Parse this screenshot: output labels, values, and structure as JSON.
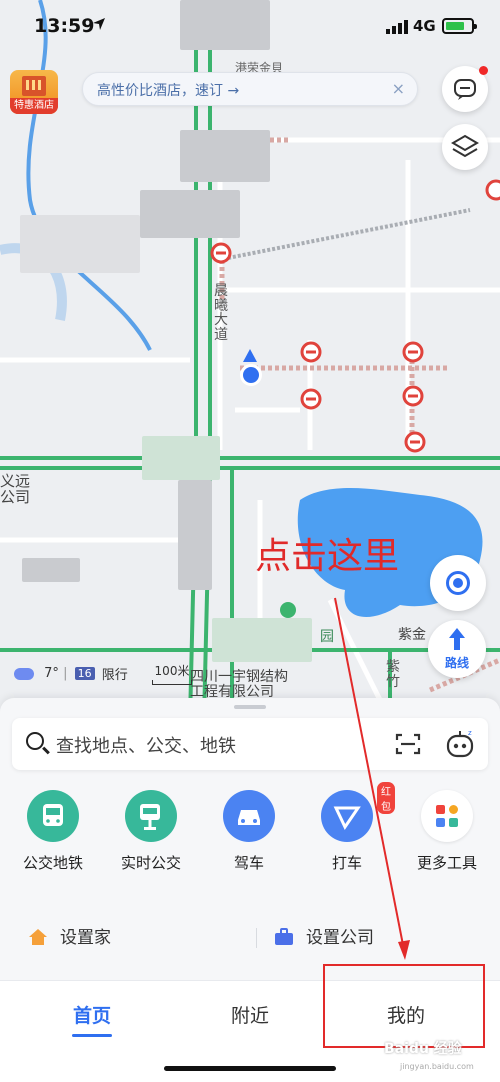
{
  "status_bar": {
    "time": "13:59",
    "network": "4G"
  },
  "map": {
    "hotel_promo_label": "特惠酒店",
    "search_hint": "高性价比酒店，速订 →",
    "search_hint_close": "×",
    "road_label_vertical": "晨曦大道",
    "partial_label_top": "港荣金貝",
    "partial_label_left": "义远\n公司",
    "label_company": "四川一宇钢结构\n工程有限公司",
    "label_park_1": "园",
    "label_park_2": "紫金",
    "label_park_vertical": "紫竹",
    "annotation_text": "点击这里",
    "route_button_label": "路线",
    "weather": {
      "temp": "7°",
      "aqi": "16",
      "restriction": "限行"
    },
    "scale_label": "100米"
  },
  "search": {
    "placeholder": "查找地点、公交、地铁"
  },
  "tools": [
    {
      "label": "公交地铁",
      "icon": "bus-icon"
    },
    {
      "label": "实时公交",
      "icon": "bus-stop-icon"
    },
    {
      "label": "驾车",
      "icon": "car-icon"
    },
    {
      "label": "打车",
      "icon": "taxi-icon",
      "badge": "红包"
    },
    {
      "label": "更多工具",
      "icon": "apps-grid-icon"
    }
  ],
  "places": {
    "home": "设置家",
    "company": "设置公司"
  },
  "tabs": [
    {
      "label": "首页",
      "active": true
    },
    {
      "label": "附近",
      "active": false
    },
    {
      "label": "我的",
      "active": false
    }
  ],
  "watermark": {
    "brand": "Baidu 经验",
    "url": "jingyan.baidu.com"
  },
  "colors": {
    "accent": "#2f6ff0",
    "annotation": "#e22a2a",
    "road_green": "#3cb46e",
    "water": "#4d9ff2"
  }
}
